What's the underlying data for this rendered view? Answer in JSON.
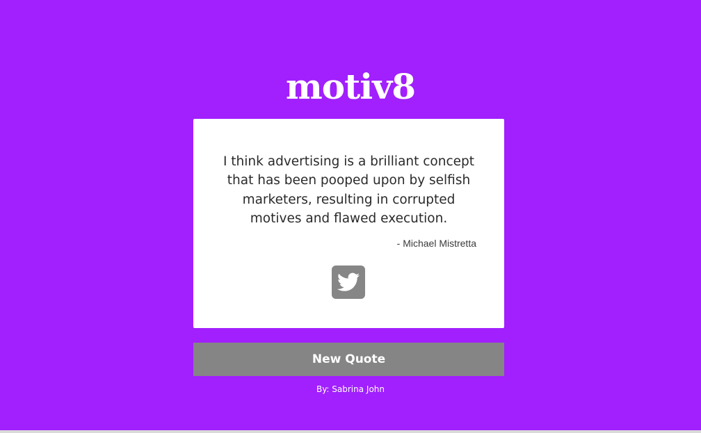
{
  "app": {
    "logo_text": "motiv8"
  },
  "quote": {
    "text": "I think advertising is a brilliant concept that has been pooped upon by selfish marketers, resulting in corrupted motives and flawed execution.",
    "author": "- Michael Mistretta"
  },
  "actions": {
    "tweet_icon": "twitter-bird-icon",
    "new_quote_label": "New Quote"
  },
  "footer": {
    "credit": "By: Sabrina John"
  },
  "colors": {
    "background": "#a120fd",
    "card": "#ffffff",
    "button": "#858585",
    "text": "#2a2a2a"
  }
}
